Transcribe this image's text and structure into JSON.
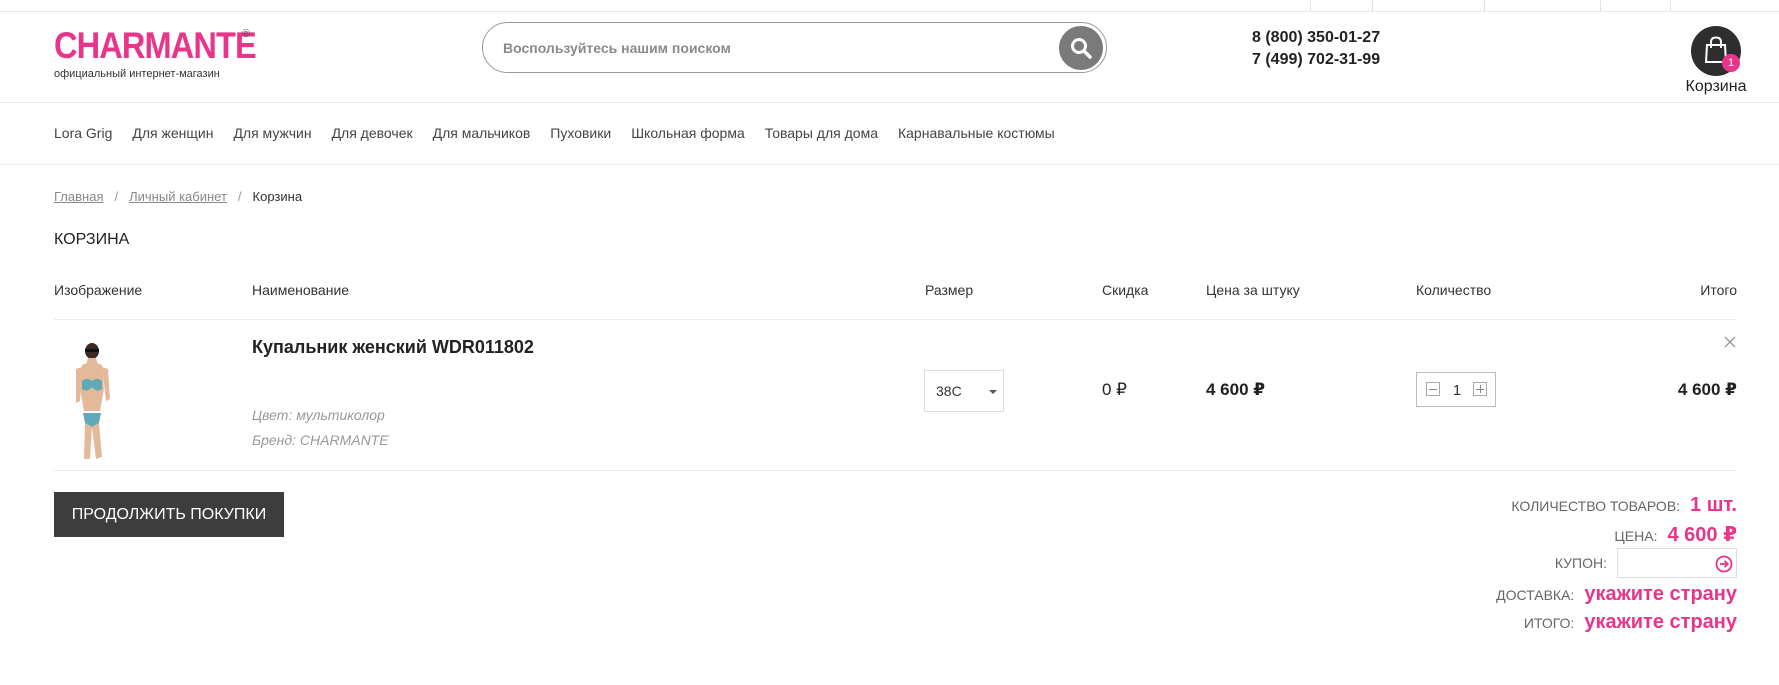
{
  "brand": {
    "name": "CHARMANTE",
    "reg": "®",
    "tagline": "официальный интернет-магазин",
    "accent_color": "#e8358a"
  },
  "search": {
    "placeholder": "Воспользуйтесь нашим поиском",
    "value": ""
  },
  "phones": [
    "8 (800) 350-01-27",
    "7 (499) 702-31-99"
  ],
  "cart": {
    "count": "1",
    "label": "Корзина"
  },
  "nav": [
    "Lora Grig",
    "Для женщин",
    "Для мужчин",
    "Для девочек",
    "Для мальчиков",
    "Пуховики",
    "Школьная форма",
    "Товары для дома",
    "Карнавальные костюмы"
  ],
  "breadcrumb": {
    "home": "Главная",
    "account": "Личный кабинет",
    "current": "Корзина",
    "separator": "/"
  },
  "page_title": "КОРЗИНА",
  "columns": {
    "image": "Изображение",
    "name": "Наименование",
    "size": "Размер",
    "discount": "Скидка",
    "unit_price": "Цена за штуку",
    "quantity": "Количество",
    "total": "Итого"
  },
  "item": {
    "name": "Купальник женский WDR011802",
    "color": "Цвет: мультиколор",
    "brand": "Бренд: CHARMANTE",
    "size": "38C",
    "discount": "0 ₽",
    "unit_price": "4 600 ₽",
    "quantity": "1",
    "total": "4 600 ₽"
  },
  "continue_label": "Продолжить покупки",
  "summary": {
    "count_label": "Количество товаров:",
    "count_value": "1 шт.",
    "price_label": "Цена:",
    "price_value": "4 600 ₽",
    "coupon_label": "Купон:",
    "coupon_value": "",
    "delivery_label": "Доставка:",
    "delivery_value": "укажите страну",
    "total_label": "Итого:",
    "total_value": "укажите страну"
  },
  "icons": {
    "search": "search-icon",
    "cart": "shopping-bag-icon",
    "remove": "close-icon",
    "coupon_submit": "arrow-circle-right-icon"
  }
}
